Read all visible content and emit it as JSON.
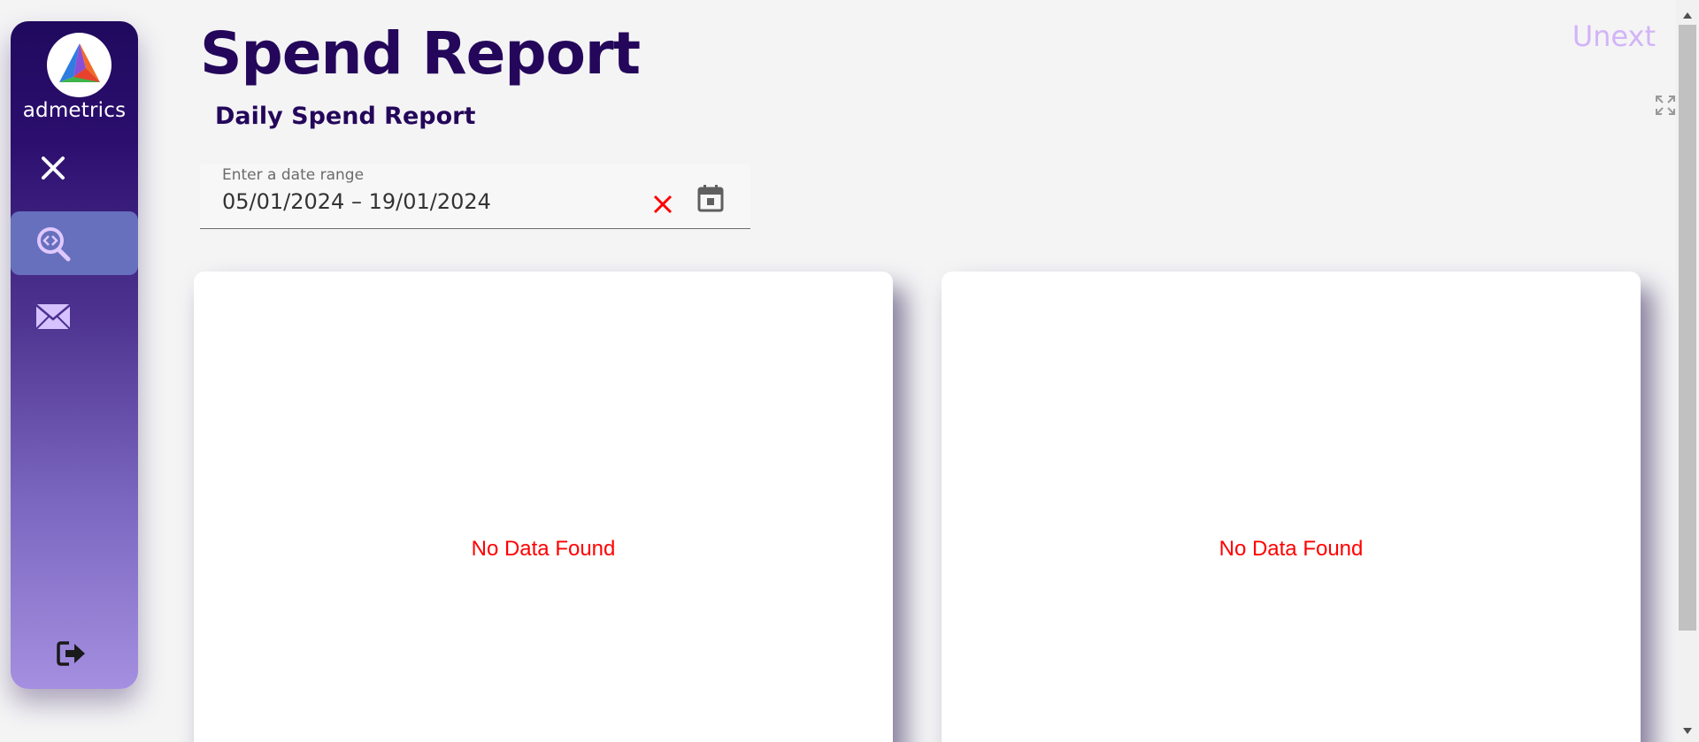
{
  "sidebar": {
    "brand": "admetrics",
    "items": [
      {
        "name": "close",
        "icon": "close-icon"
      },
      {
        "name": "spend-report",
        "icon": "search-code-icon",
        "active": true
      },
      {
        "name": "mail",
        "icon": "mail-icon"
      }
    ],
    "logout_icon": "logout-icon"
  },
  "header": {
    "title": "Spend Report",
    "subtitle": "Daily Spend Report",
    "brand_link": "Unext"
  },
  "date_range": {
    "label": "Enter a date range",
    "value": "05/01/2024 – 19/01/2024"
  },
  "panels": [
    {
      "message": "No Data Found"
    },
    {
      "message": "No Data Found"
    }
  ],
  "colors": {
    "primary": "#24075a",
    "accent": "#6770bd",
    "error": "#ff0000",
    "brand_link": "#d3b4f7"
  }
}
